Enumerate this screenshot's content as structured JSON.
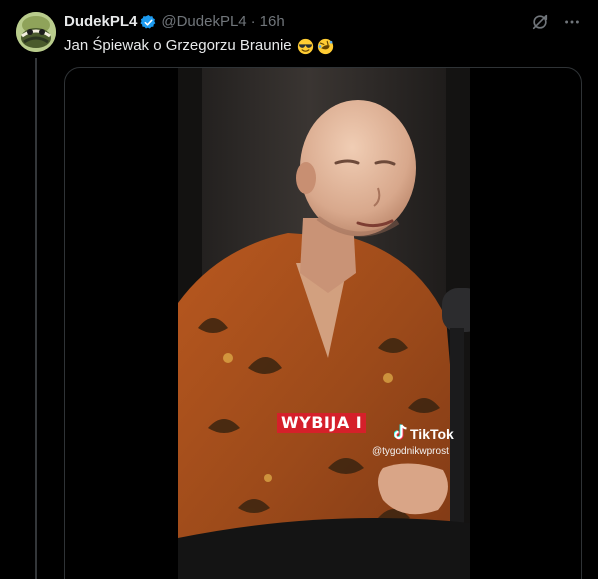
{
  "author": {
    "display_name": "DudekPL4",
    "handle": "@DudekPL4",
    "separator": "·",
    "time": "16h"
  },
  "tweet": {
    "text": "Jan Śpiewak o Grzegorzu Braunie",
    "emojis": [
      "smiling-face-with-sunglasses",
      "rolling-on-the-floor-laughing"
    ]
  },
  "video": {
    "overlay_label": "WYBIJA I",
    "watermark_brand": "TikTok",
    "watermark_handle": "@tygodnikwprost"
  },
  "icons": {
    "verified": "verified-badge-icon",
    "grok": "grok-icon",
    "more": "more-icon"
  },
  "colors": {
    "background": "#000000",
    "text_primary": "#e7e9ea",
    "text_secondary": "#71767b",
    "verified_blue": "#1d9bf0",
    "label_red": "#d5202a"
  }
}
